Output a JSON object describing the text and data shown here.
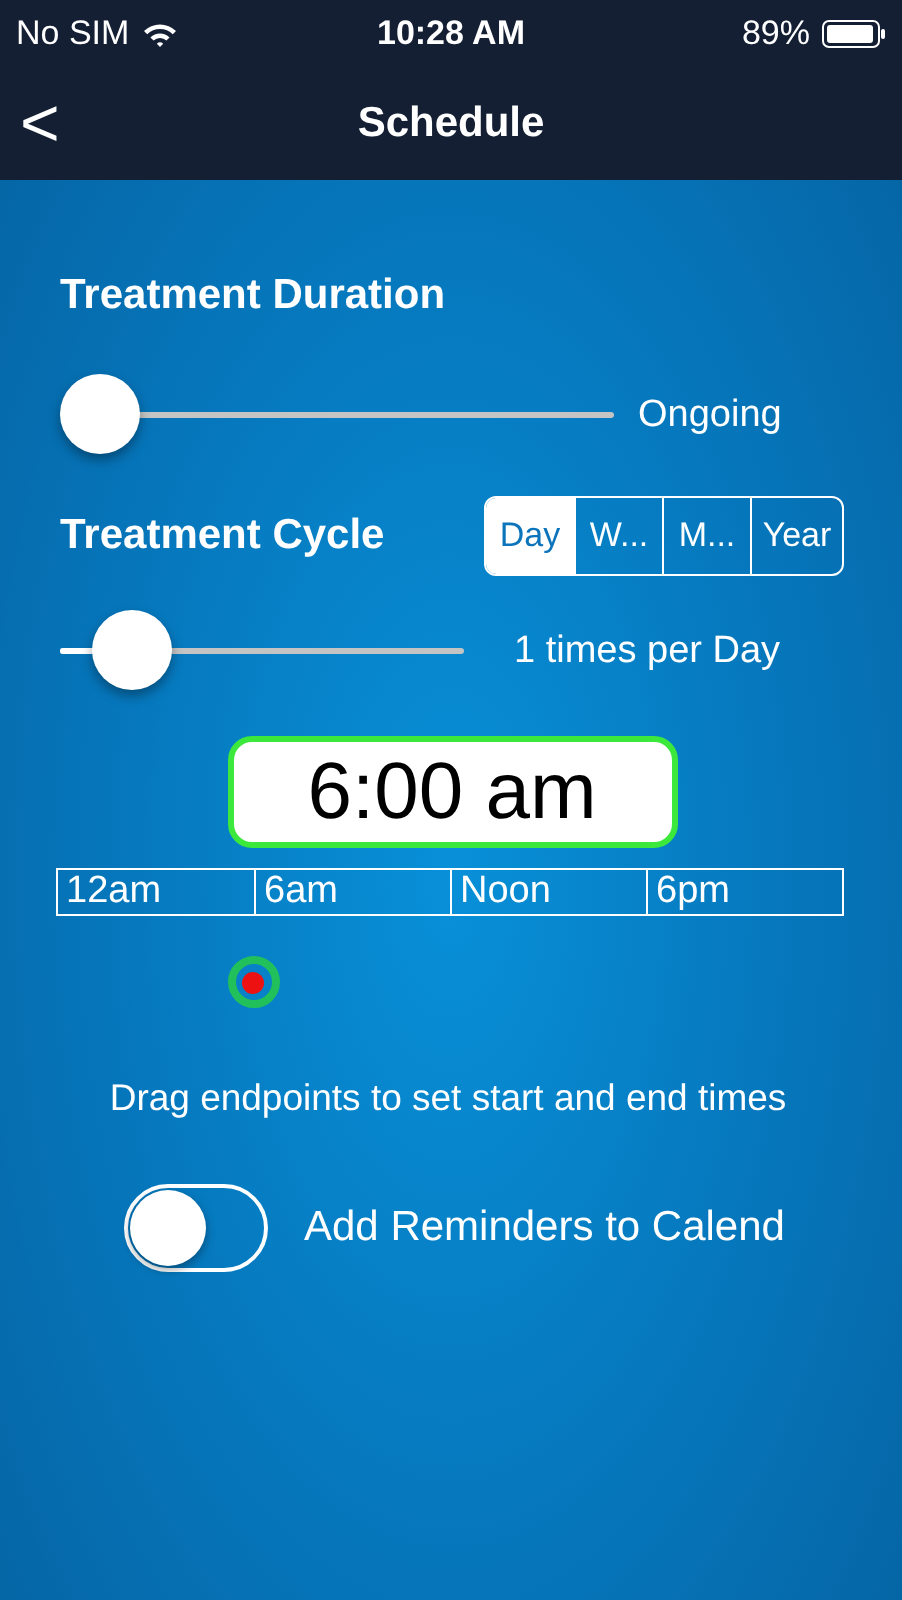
{
  "status_bar": {
    "carrier": "No SIM",
    "time": "10:28 AM",
    "battery": "89%"
  },
  "nav": {
    "back": "<",
    "title": "Schedule"
  },
  "duration": {
    "heading": "Treatment Duration",
    "level": 0,
    "reading": "Ongoing"
  },
  "cycle": {
    "heading": "Treatment Cycle",
    "segments": [
      {
        "label": "Day",
        "selected": true
      },
      {
        "label": "W...",
        "selected": false
      },
      {
        "label": "M...",
        "selected": false
      },
      {
        "label": "Year",
        "selected": false
      }
    ],
    "level": 0.1,
    "reading": "1 times per Day"
  },
  "time_display": "6:00 am",
  "timeline": {
    "labels": [
      "12am",
      "6am",
      "Noon",
      "6pm"
    ]
  },
  "hint": "Drag endpoints to set start and end times",
  "reminders": {
    "label": "Add Reminders to Calend",
    "on": false
  }
}
